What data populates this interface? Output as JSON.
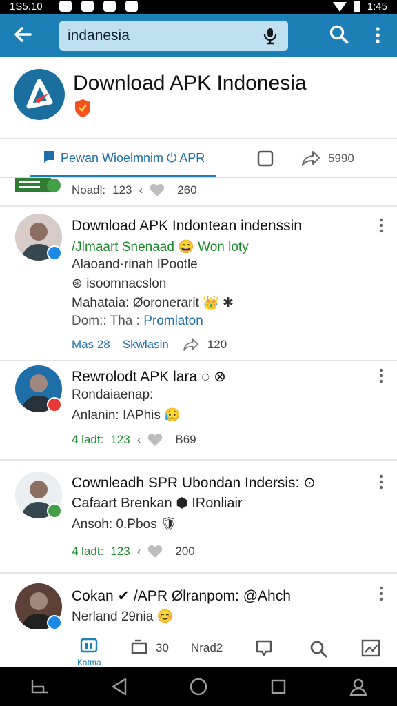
{
  "status_bar": {
    "time": "1S5.10",
    "right_time": "1:45"
  },
  "app_bar": {
    "search_value": "indanesia"
  },
  "header": {
    "title": "Download APK Indonesia"
  },
  "tabs": {
    "main_label": "Pewan Wioelmnim ⏻ APR",
    "share_count": "5990"
  },
  "partial_item": {
    "stats": {
      "left": "Noadl:",
      "count": "123",
      "heart_count": "260"
    }
  },
  "posts": [
    {
      "title": "Download APK Indontean indenssin",
      "line1": "/Jlmaart Snenaad 😄 Won loty",
      "line2": "Alaoand·rinah IPootle",
      "line3": "⊛ isoomnacslon",
      "line4": "Mahataia: Øoronerarit 👑 ✱",
      "line5_left": "Dom:: Tha  :",
      "line5_link": "Promlaton",
      "stats": {
        "left": "Mas  28",
        "label": "Skwlasin",
        "share_count": "120"
      }
    },
    {
      "title": "Rewrolodt APK lara ◌ ⊗",
      "line1": "Rondaiaenap:",
      "line2": "Anlanin: IAPhis 😥",
      "stats": {
        "left": "4 ladt:",
        "count": "123",
        "heart_count": "B69"
      }
    },
    {
      "title": "Cownleadh SPR Ubondan Indersis: ⊙",
      "line1": "Cafaart Brenkan ⬢ IRonliair",
      "line2": "Ansoh: 0.Pbos 🛡",
      "stats": {
        "left": "4 ladt:",
        "count": "123",
        "heart_count": "200"
      }
    },
    {
      "title": "Cokan ✔ /APR Ølranpom: @Ahch",
      "line1": "Nerland 29nia 😊"
    }
  ],
  "bottom_nav": {
    "home_label": "Katma",
    "count": "30",
    "label2": "Nrad2"
  },
  "colors": {
    "brand": "#1c7fb6",
    "link": "#1c6fa8",
    "green": "#1a8a2a"
  }
}
